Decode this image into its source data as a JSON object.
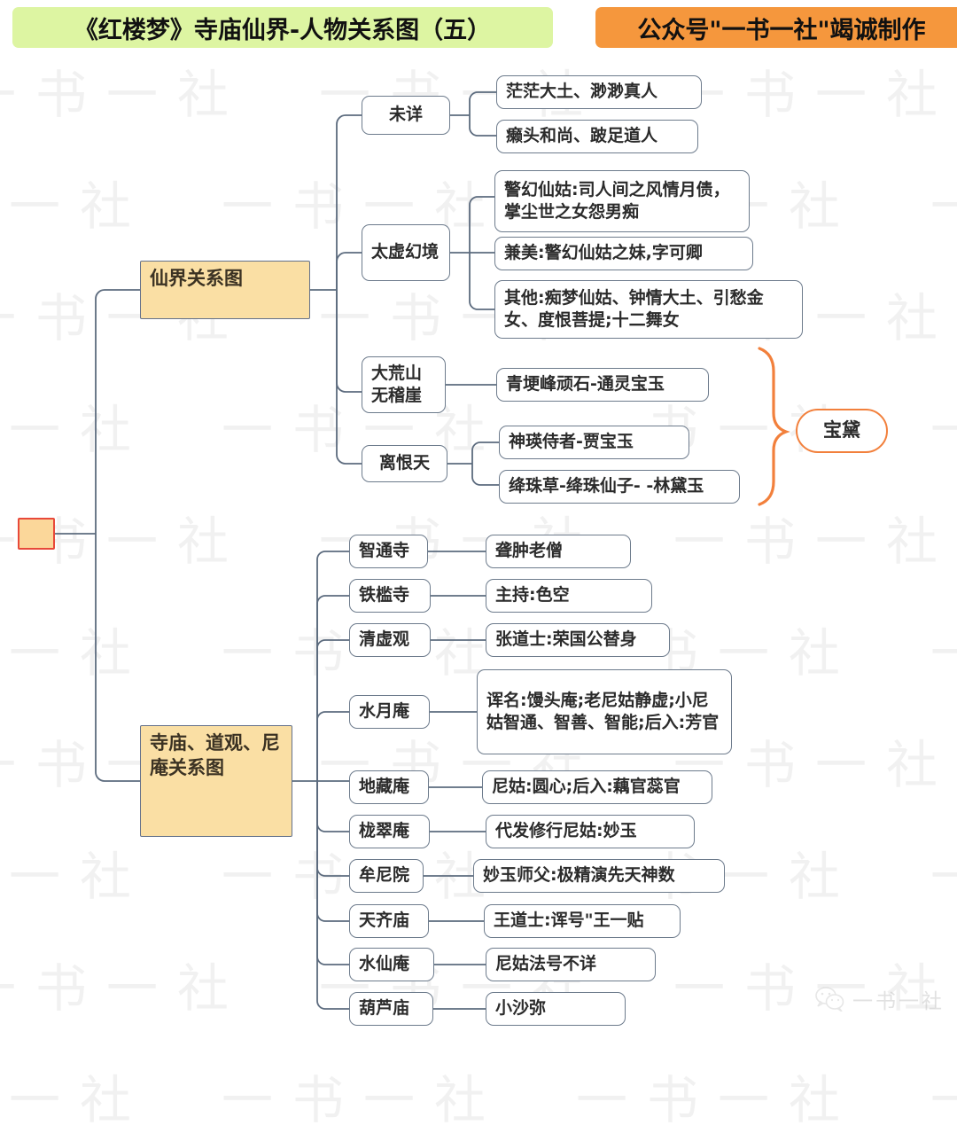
{
  "header": {
    "title": "《红楼梦》寺庙仙界-人物关系图（五）",
    "promo": "公众号\"一书一社\"竭诚制作"
  },
  "watermark": {
    "text": "一书一社",
    "brand_text": "一书一社",
    "icon": "wechat-icon"
  },
  "root": {
    "label": ""
  },
  "branches": [
    {
      "id": "immortal",
      "label": "仙界关系图",
      "children": [
        {
          "label": "未详",
          "items": [
            "茫茫大土、渺渺真人",
            "癞头和尚、跛足道人"
          ]
        },
        {
          "label": "太虚幻境",
          "items": [
            "警幻仙姑:司人间之风情月债，掌尘世之女怨男痴",
            "兼美:警幻仙姑之妹,字可卿",
            "其他:痴梦仙姑、钟情大土、引愁金女、度恨菩提;十二舞女"
          ]
        },
        {
          "label": "大荒山无稽崖",
          "items": [
            "青埂峰顽石-通灵宝玉"
          ]
        },
        {
          "label": "离恨天",
          "items": [
            "神瑛侍者-贾宝玉",
            "绛珠草-绛珠仙子- -林黛玉"
          ]
        }
      ],
      "annotation": {
        "label": "宝黛",
        "brace": "right-curly-brace"
      }
    },
    {
      "id": "temples",
      "label": "寺庙、道观、尼庵关系图",
      "children": [
        {
          "label": "智通寺",
          "items": [
            "聋肿老僧"
          ]
        },
        {
          "label": "铁槛寺",
          "items": [
            "主持:色空"
          ]
        },
        {
          "label": "清虚观",
          "items": [
            "张道士:荣国公替身"
          ]
        },
        {
          "label": "水月庵",
          "items": [
            "诨名:馒头庵;老尼姑静虚;小尼姑智通、智善、智能;后入:芳官"
          ]
        },
        {
          "label": "地藏庵",
          "items": [
            "尼姑:圆心;后入:藕官蕊官"
          ]
        },
        {
          "label": "栊翠庵",
          "items": [
            "代发修行尼姑:妙玉"
          ]
        },
        {
          "label": "牟尼院",
          "items": [
            "妙玉师父:极精演先天神数"
          ]
        },
        {
          "label": "天齐庙",
          "items": [
            "王道士:诨号\"王一贴"
          ]
        },
        {
          "label": "水仙庵",
          "items": [
            "尼姑法号不详"
          ]
        },
        {
          "label": "葫芦庙",
          "items": [
            "小沙弥"
          ]
        }
      ]
    }
  ],
  "colors": {
    "header_title_bg": "#ddf5a2",
    "header_promo_bg": "#f5973d",
    "branch_node_bg": "#fadfa4",
    "root_border": "#e8493a",
    "wire": "#5c6b7e",
    "accent_orange": "#f2803c"
  }
}
